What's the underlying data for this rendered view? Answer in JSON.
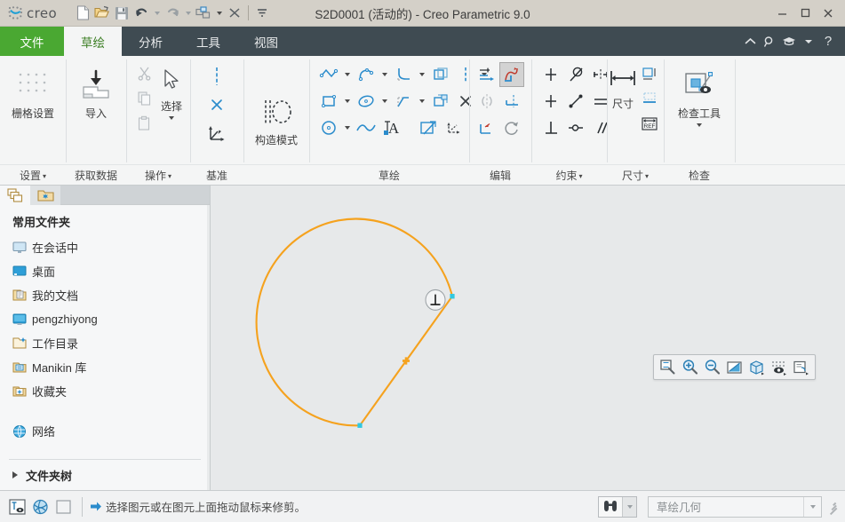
{
  "window": {
    "title": "S2D0001 (活动的) - Creo Parametric 9.0",
    "brand": "creo",
    "minimize": "—",
    "maximize": "☐",
    "close": "✕"
  },
  "quick_access": [
    {
      "name": "new-file-icon",
      "tip": "新建"
    },
    {
      "name": "open-file-icon",
      "tip": "打开"
    },
    {
      "name": "save-icon",
      "tip": "保存"
    },
    {
      "name": "undo-icon",
      "tip": "撤消"
    },
    {
      "name": "redo-icon",
      "tip": "重做"
    },
    {
      "name": "regenerate-icon",
      "tip": "重新生成"
    },
    {
      "name": "close-window-icon",
      "tip": "关闭"
    },
    {
      "name": "customize-qat-icon",
      "tip": "自定义快速访问工具栏"
    }
  ],
  "tabs": [
    {
      "label": "文件",
      "kind": "file"
    },
    {
      "label": "草绘",
      "kind": "active"
    },
    {
      "label": "分析",
      "kind": "normal"
    },
    {
      "label": "工具",
      "kind": "normal"
    },
    {
      "label": "视图",
      "kind": "normal"
    }
  ],
  "tab_right_icons": [
    {
      "name": "collapse-ribbon-icon",
      "glyph": "︿"
    },
    {
      "name": "search-icon",
      "glyph": "search"
    },
    {
      "name": "learning-icon",
      "glyph": "cap"
    },
    {
      "name": "learning-dropdown-icon",
      "glyph": "caret"
    },
    {
      "name": "help-icon",
      "glyph": "?"
    }
  ],
  "ribbon": {
    "groups": [
      {
        "id": "settings",
        "label": "设置",
        "has_dropdown": true,
        "big_buttons": [
          {
            "name": "grid-settings-button",
            "caption": "栅格设置",
            "icon": "grid-dots-icon"
          }
        ]
      },
      {
        "id": "get-data",
        "label": "获取数据",
        "has_dropdown": false,
        "big_buttons": [
          {
            "name": "import-button",
            "caption": "导入",
            "icon": "import-icon"
          }
        ]
      },
      {
        "id": "operations",
        "label": "操作",
        "has_dropdown": true,
        "small_buttons": [
          {
            "name": "cut-button",
            "icon": "scissors-icon",
            "disabled": true
          },
          {
            "name": "copy-button",
            "icon": "copy-icon",
            "disabled": true
          },
          {
            "name": "paste-button",
            "icon": "paste-icon",
            "disabled": true
          }
        ],
        "big_buttons": [
          {
            "name": "select-button",
            "caption": "选择",
            "icon": "cursor-arrow-icon",
            "has_dropdown": true
          }
        ]
      },
      {
        "id": "datum",
        "label": "基准",
        "has_dropdown": false,
        "small_buttons": [
          {
            "name": "centerline-button",
            "icon": "centerline-icon"
          },
          {
            "name": "datum-point-button",
            "icon": "datum-point-icon"
          },
          {
            "name": "coordinate-system-button",
            "icon": "coordinate-system-icon"
          }
        ]
      },
      {
        "id": "construction-mode",
        "label": "",
        "has_dropdown": false,
        "big_buttons": [
          {
            "name": "construction-mode-button",
            "caption": "构造模式",
            "icon": "construction-mode-icon"
          }
        ]
      },
      {
        "id": "sketching",
        "label": "草绘",
        "has_dropdown": false,
        "rows": [
          [
            {
              "name": "line-chain-button",
              "icon": "line-chain-icon",
              "dropdown": true
            },
            {
              "name": "arc-button",
              "icon": "arc-icon",
              "dropdown": true
            },
            {
              "name": "fillet-button",
              "icon": "fillet-icon",
              "dropdown": true
            },
            {
              "name": "offset-button",
              "icon": "offset-icon",
              "dropdown": false
            },
            {
              "name": "construction-line-button",
              "icon": "construction-line-icon",
              "dropdown": true
            }
          ],
          [
            {
              "name": "rectangle-button",
              "icon": "rectangle-icon",
              "dropdown": true
            },
            {
              "name": "ellipse-button",
              "icon": "ellipse-icon",
              "dropdown": true
            },
            {
              "name": "chamfer-button",
              "icon": "chamfer-icon",
              "dropdown": true
            },
            {
              "name": "thicken-button",
              "icon": "thicken-icon",
              "dropdown": false
            },
            {
              "name": "point-button",
              "icon": "point-x-icon",
              "dropdown": false
            }
          ],
          [
            {
              "name": "circle-button",
              "icon": "circle-icon",
              "dropdown": true
            },
            {
              "name": "spline-button",
              "icon": "spline-icon",
              "dropdown": false
            },
            {
              "name": "text-button",
              "icon": "text-icon",
              "dropdown": false
            },
            {
              "name": "project-button",
              "icon": "project-icon",
              "dropdown": false
            },
            {
              "name": "coordinate-sys-sketch-button",
              "icon": "csys-sketch-icon",
              "dropdown": false
            }
          ]
        ]
      },
      {
        "id": "editing",
        "label": "编辑",
        "has_dropdown": false,
        "rows": [
          [
            {
              "name": "modify-button",
              "icon": "modify-icon",
              "selected": false
            },
            {
              "name": "delete-segment-button",
              "icon": "trim-delete-segment-icon",
              "selected": true
            }
          ],
          [
            {
              "name": "mirror-button",
              "icon": "mirror-icon",
              "disabled": true
            },
            {
              "name": "divide-button",
              "icon": "divide-icon",
              "selected": false
            }
          ],
          [
            {
              "name": "corner-button",
              "icon": "corner-trim-icon",
              "selected": false
            },
            {
              "name": "rotate-resize-button",
              "icon": "rotate-resize-icon",
              "selected": false
            }
          ]
        ]
      },
      {
        "id": "constrain",
        "label": "约束",
        "has_dropdown": true,
        "rows": [
          [
            {
              "name": "vertical-constraint-button",
              "icon": "vertical-constraint-icon"
            },
            {
              "name": "tangent-constraint-button",
              "icon": "tangent-constraint-icon"
            },
            {
              "name": "symmetric-constraint-button",
              "icon": "symmetric-constraint-icon"
            }
          ],
          [
            {
              "name": "horizontal-constraint-button",
              "icon": "horizontal-constraint-icon"
            },
            {
              "name": "midpoint-constraint-button",
              "icon": "midpoint-constraint-icon"
            },
            {
              "name": "equal-constraint-button",
              "icon": "equal-constraint-icon"
            }
          ],
          [
            {
              "name": "perpendicular-constraint-button",
              "icon": "perpendicular-constraint-icon"
            },
            {
              "name": "coincident-constraint-button",
              "icon": "coincident-constraint-icon"
            },
            {
              "name": "parallel-constraint-button",
              "icon": "parallel-constraint-icon"
            }
          ]
        ]
      },
      {
        "id": "dimension",
        "label": "尺寸",
        "has_dropdown": true,
        "big_buttons": [
          {
            "name": "dimension-button",
            "caption": "尺寸",
            "icon": "dimension-icon"
          }
        ],
        "small_buttons": [
          {
            "name": "perimeter-dimension-button",
            "icon": "perimeter-dimension-icon"
          },
          {
            "name": "baseline-dimension-button",
            "icon": "baseline-dimension-icon"
          },
          {
            "name": "reference-dimension-button",
            "icon": "reference-dimension-icon"
          }
        ]
      },
      {
        "id": "inspect",
        "label": "检查",
        "has_dropdown": false,
        "big_buttons": [
          {
            "name": "inspect-tools-button",
            "caption": "检查工具",
            "icon": "inspect-tools-icon",
            "has_dropdown": true
          }
        ]
      }
    ]
  },
  "navigator": {
    "tabs": [
      {
        "name": "model-tree-tab",
        "icon": "model-tree-icon",
        "active": true
      },
      {
        "name": "folder-browser-tab",
        "icon": "favorites-folder-icon",
        "active": false
      }
    ],
    "header": "常用文件夹",
    "items": [
      {
        "label": "在会话中",
        "icon": "in-session-icon"
      },
      {
        "label": "桌面",
        "icon": "desktop-icon"
      },
      {
        "label": "我的文档",
        "icon": "my-documents-icon"
      },
      {
        "label": "pengzhiyong",
        "icon": "user-home-icon"
      },
      {
        "label": "工作目录",
        "icon": "working-directory-icon"
      },
      {
        "label": "Manikin 库",
        "icon": "manikin-library-icon"
      },
      {
        "label": "收藏夹",
        "icon": "favorites-icon"
      }
    ],
    "network": {
      "label": "网络",
      "icon": "network-icon"
    },
    "folder_tree": {
      "label": "文件夹树",
      "icon": "expand-triangle-icon"
    }
  },
  "graphics_toolbar": [
    {
      "name": "zoom-to-fit-icon",
      "tip": "重新调整"
    },
    {
      "name": "zoom-in-icon",
      "tip": "放大"
    },
    {
      "name": "zoom-out-icon",
      "tip": "缩小"
    },
    {
      "name": "repaint-icon",
      "tip": "重画"
    },
    {
      "name": "display-style-icon",
      "tip": "显示样式"
    },
    {
      "name": "datum-display-icon",
      "tip": "基准显示过滤器"
    },
    {
      "name": "annotation-display-icon",
      "tip": "注释显示"
    }
  ],
  "canvas": {
    "background": "#e7e9ea",
    "sketch_color": "#f5a21e",
    "vertex_color": "#31c8e0",
    "constraint_badge": "⊥",
    "constraint_name": "perpendicular-constraint-marker"
  },
  "status_bar": {
    "left_icons": [
      {
        "name": "model-display-toggle-icon"
      },
      {
        "name": "spin-center-icon"
      },
      {
        "name": "selection-box-icon"
      }
    ],
    "message": "选择图元或在图元上面拖动鼠标来修剪。",
    "message_arrow": "➡",
    "find_button": "find-tool-icon",
    "filter_value": "草绘几何",
    "resize_grip": "resize-grip-icon"
  }
}
